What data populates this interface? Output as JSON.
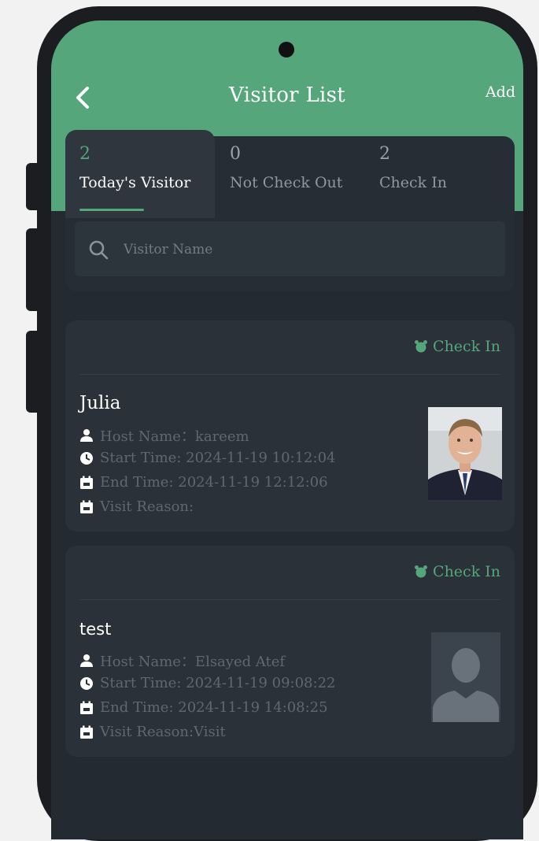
{
  "header": {
    "title": "Visitor List",
    "add_label": "Add"
  },
  "tabs": [
    {
      "count": "2",
      "label": "Today's Visitor",
      "active": true
    },
    {
      "count": "0",
      "label": "Not Check Out",
      "active": false
    },
    {
      "count": "2",
      "label": "Check In",
      "active": false
    }
  ],
  "search": {
    "placeholder": "Visitor Name"
  },
  "visitors": [
    {
      "status": "Check In",
      "name": "Julia",
      "host": "Host Name：kareem",
      "start_time": "Start Time: 2024-11-19 10:12:04",
      "end_time": "End Time: 2024-11-19 12:12:06",
      "visit_reason": "Visit Reason:",
      "photo": "person-photo"
    },
    {
      "status": "Check In",
      "name": "test",
      "host": "Host Name：Elsayed Atef",
      "start_time": "Start Time: 2024-11-19 09:08:22",
      "end_time": "End Time: 2024-11-19 14:08:25",
      "visit_reason": "Visit Reason:Visit",
      "photo": "avatar-placeholder"
    }
  ],
  "colors": {
    "accent": "#55a67a",
    "background": "#232a31",
    "card": "#2a3138"
  }
}
